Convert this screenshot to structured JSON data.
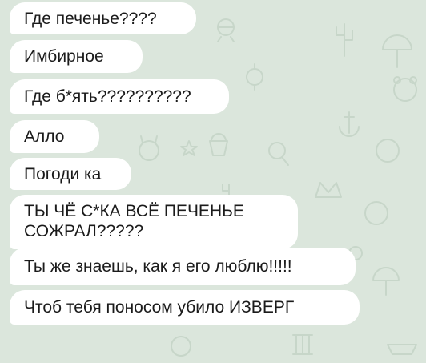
{
  "chat": {
    "background_color": "#dbe6dc",
    "bubble_color": "#ffffff",
    "text_color": "#1b1b1b",
    "messages": [
      {
        "text": "Где печенье????"
      },
      {
        "text": "Имбирное"
      },
      {
        "text": "Где б*ять??????????"
      },
      {
        "text": "Алло"
      },
      {
        "text": "Погоди ка"
      },
      {
        "lines": [
          "ТЫ ЧЁ С*КА ВСЁ ПЕЧЕНЬЕ",
          "СОЖРАЛ?????"
        ]
      },
      {
        "text": "Ты же знаешь, как я его люблю!!!!!"
      },
      {
        "text": "Чтоб тебя поносом убило ИЗВЕРГ"
      }
    ]
  }
}
